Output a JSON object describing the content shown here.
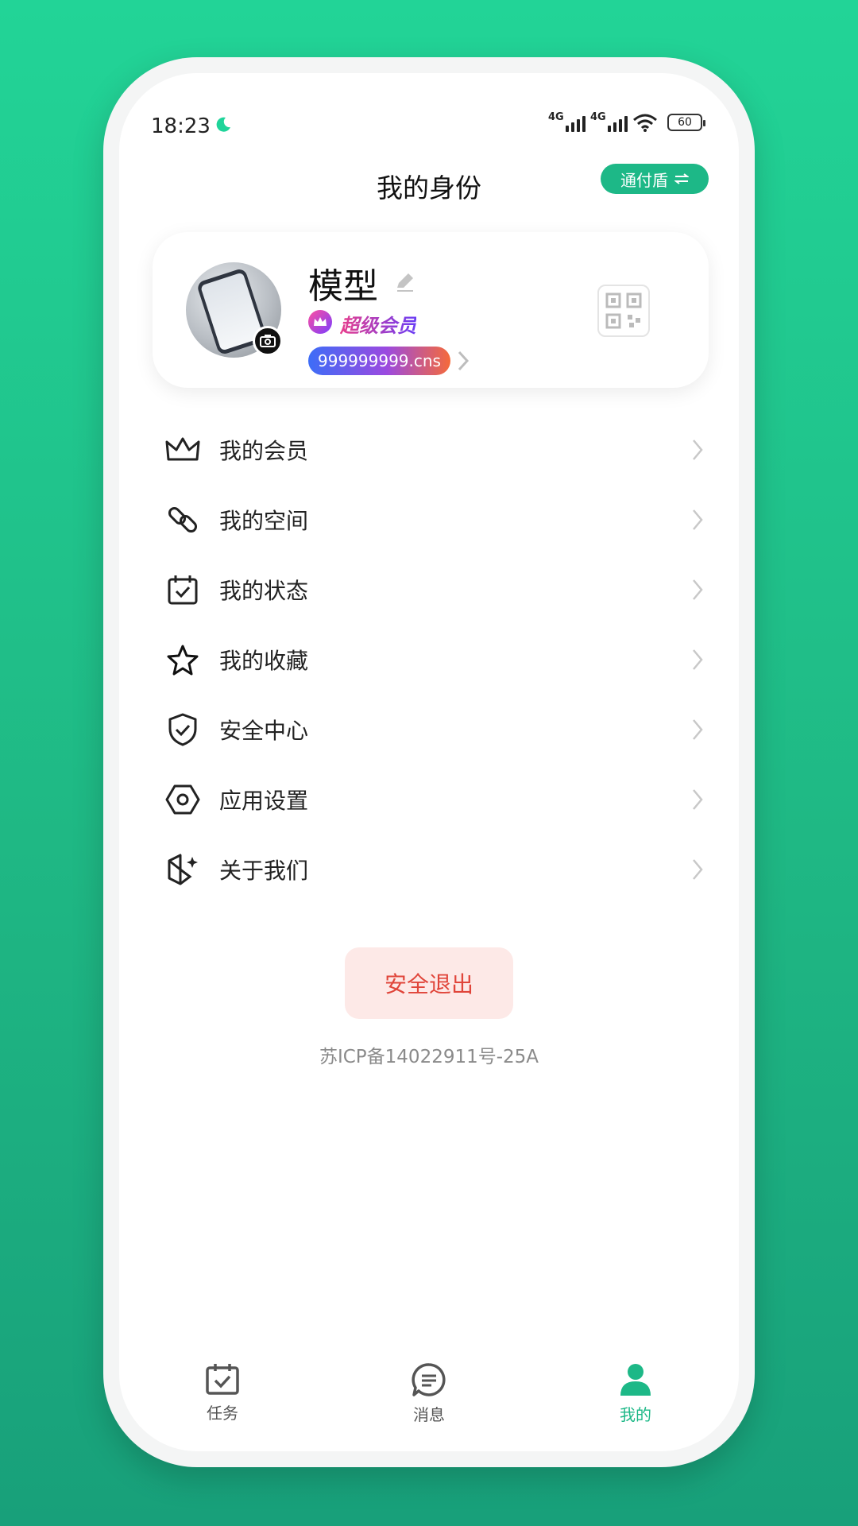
{
  "status_bar": {
    "time": "18:23",
    "network_1": "4G",
    "network_2": "4G",
    "battery": "60"
  },
  "header": {
    "title": "我的身份",
    "shield_button": "通付盾",
    "shield_button_icon": "swap-arrows-icon"
  },
  "profile": {
    "name": "模型",
    "membership": "超级会员",
    "user_id": "999999999.cns"
  },
  "menu": {
    "items": [
      {
        "label": "我的会员",
        "icon": "crown-icon"
      },
      {
        "label": "我的空间",
        "icon": "link-icon"
      },
      {
        "label": "我的状态",
        "icon": "calendar-check-icon"
      },
      {
        "label": "我的收藏",
        "icon": "star-icon"
      },
      {
        "label": "安全中心",
        "icon": "shield-check-icon"
      },
      {
        "label": "应用设置",
        "icon": "hexagon-settings-icon"
      },
      {
        "label": "关于我们",
        "icon": "cube-sparkle-icon"
      }
    ]
  },
  "logout_label": "安全退出",
  "icp": "苏ICP备14022911号-25A",
  "tabs": [
    {
      "label": "任务",
      "icon": "task-calendar-icon"
    },
    {
      "label": "消息",
      "icon": "message-bubble-icon"
    },
    {
      "label": "我的",
      "icon": "person-icon",
      "active": true
    }
  ],
  "colors": {
    "accent": "#1db887",
    "logout_text": "#e0453a",
    "background": "#22d497"
  }
}
